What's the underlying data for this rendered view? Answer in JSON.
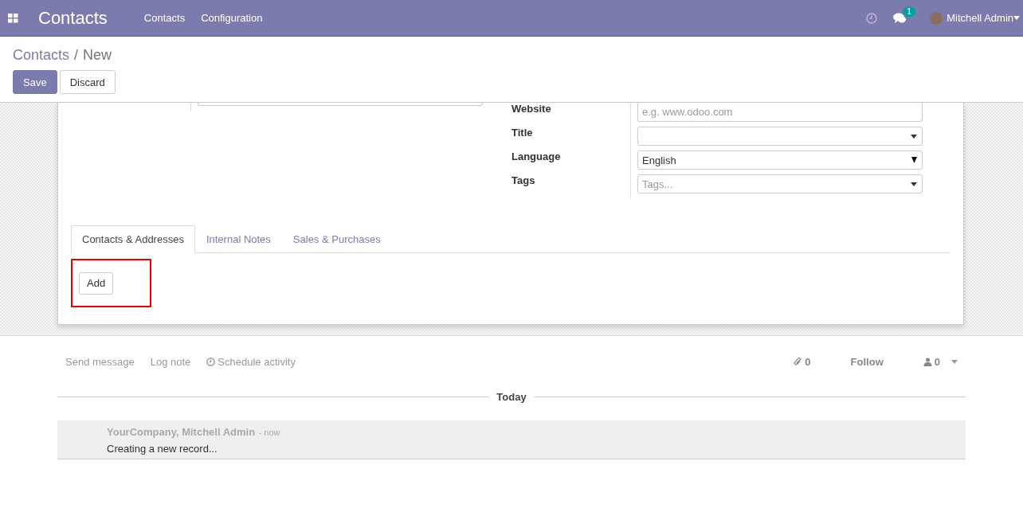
{
  "navbar": {
    "app_title": "Contacts",
    "menu": [
      "Contacts",
      "Configuration"
    ],
    "messages_badge": "1",
    "user": "Mitchell Admin"
  },
  "breadcrumb": {
    "parent": "Contacts",
    "separator": "/",
    "current": "New"
  },
  "buttons": [
    {
      "label": "Save",
      "kind": "primary"
    },
    {
      "label": "Discard",
      "kind": "secondary"
    }
  ],
  "fields": [
    {
      "label": "Website",
      "kind": "text",
      "placeholder": "e.g. www.odoo.com"
    },
    {
      "label": "Title",
      "kind": "many2one"
    },
    {
      "label": "Language",
      "kind": "select",
      "value": "English"
    },
    {
      "label": "Tags",
      "kind": "tags",
      "placeholder": "Tags..."
    }
  ],
  "tabs": [
    {
      "label": "Contacts & Addresses",
      "selected": true
    },
    {
      "label": "Internal Notes",
      "selected": false
    },
    {
      "label": "Sales & Purchases",
      "selected": false
    }
  ],
  "tab_content": {
    "add_button": "Add",
    "highlighted": true
  },
  "chatter": {
    "send_message": "Send message",
    "log_note": "Log note",
    "schedule_activity": "Schedule activity",
    "attachments": "0",
    "follow": "Follow",
    "followers": "0",
    "date_separator": "Today",
    "messages": [
      {
        "author": "YourCompany, Mitchell Admin",
        "time_separator": "-",
        "time": "now",
        "body": "Creating a new record..."
      }
    ]
  }
}
